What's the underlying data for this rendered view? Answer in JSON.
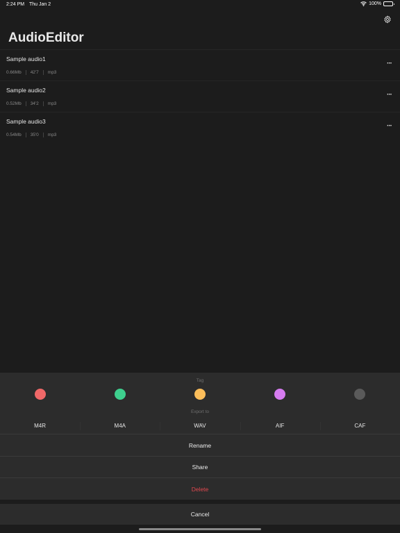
{
  "status": {
    "time": "2:24 PM",
    "date": "Thu Jan 2",
    "battery": "100%"
  },
  "app": {
    "title": "AudioEditor",
    "settings_icon": "gear-icon"
  },
  "files": [
    {
      "name": "Sample audio1",
      "size": "0.66Mb",
      "duration": "42'7",
      "format": "mp3"
    },
    {
      "name": "Sample audio2",
      "size": "0.52Mb",
      "duration": "34'2",
      "format": "mp3"
    },
    {
      "name": "Sample audio3",
      "size": "0.54Mb",
      "duration": "35'0",
      "format": "mp3"
    }
  ],
  "sheet": {
    "tag_label": "Tag",
    "tags": [
      {
        "color": "#f06868"
      },
      {
        "color": "#3ecf8e"
      },
      {
        "color": "#fbbd5a"
      },
      {
        "color": "#d67cf0"
      },
      {
        "color": "#5a5a5a"
      }
    ],
    "export_label": "Export to",
    "export_options": [
      "M4R",
      "M4A",
      "WAV",
      "AIF",
      "CAF"
    ],
    "rename": "Rename",
    "share": "Share",
    "delete": "Delete",
    "delete_color": "#e0484f",
    "cancel": "Cancel"
  }
}
